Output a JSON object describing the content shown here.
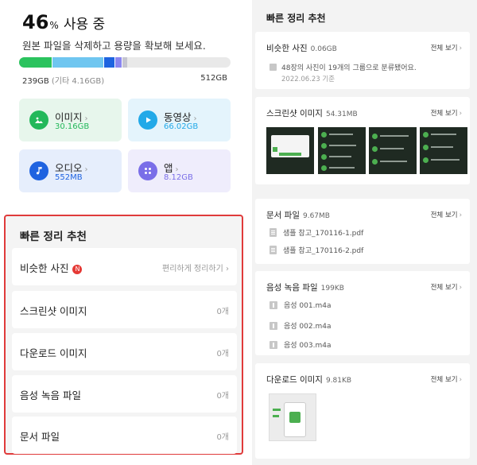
{
  "usage": {
    "percent": "46",
    "percent_unit": "%",
    "label": "사용 중",
    "subtitle": "원본 파일을 삭제하고 용량을 확보해 보세요.",
    "used": "239GB",
    "other": "(기타 4.16GB)",
    "total": "512GB",
    "bar_segments": [
      {
        "color": "#2bc35e",
        "fraction": 0.155
      },
      {
        "color": "#6fc6f0",
        "fraction": 0.245
      },
      {
        "color": "#1e64e0",
        "fraction": 0.05
      },
      {
        "color": "#8a86f0",
        "fraction": 0.035
      },
      {
        "color": "#c5c5d0",
        "fraction": 0.025
      }
    ]
  },
  "categories": [
    {
      "name": "이미지",
      "size": "30.16GB",
      "icon": "image-icon",
      "color": "#22b85a",
      "bg": "#e7f6ec",
      "size_color": "#22b85a"
    },
    {
      "name": "동영상",
      "size": "66.02GB",
      "icon": "play-icon",
      "color": "#22a9e8",
      "bg": "#e4f4fc",
      "size_color": "#22a9e8"
    },
    {
      "name": "오디오",
      "size": "552MB",
      "icon": "music-icon",
      "color": "#1f63e0",
      "bg": "#e6eefc",
      "size_color": "#1f63e0"
    },
    {
      "name": "앱",
      "size": "8.12GB",
      "icon": "apps-icon",
      "color": "#7a6ee8",
      "bg": "#efedfc",
      "size_color": "#7a6ee8"
    }
  ],
  "quick_clean": {
    "title": "빠른 정리 추천",
    "rows": [
      {
        "label": "비슷한 사진",
        "badge": "N",
        "value": "편리하게 정리하기"
      },
      {
        "label": "스크린샷 이미지",
        "value": "0개"
      },
      {
        "label": "다운로드 이미지",
        "value": "0개"
      },
      {
        "label": "음성 녹음 파일",
        "value": "0개"
      },
      {
        "label": "문서 파일",
        "value": "0개"
      }
    ]
  },
  "right": {
    "title": "빠른 정리 추천",
    "view_all": "전체 보기",
    "similar": {
      "title": "비슷한 사진",
      "size": "0.06GB",
      "desc": "48장의 사진이 19개의 그룹으로 분류됐어요.",
      "date": "2022.06.23 기준"
    },
    "screenshots": {
      "title": "스크린샷 이미지",
      "size": "54.31MB"
    },
    "docs": {
      "title": "문서 파일",
      "size": "9.67MB",
      "files": [
        "샘플 참고_170116-1.pdf",
        "샘플 참고_170116-2.pdf"
      ]
    },
    "voice": {
      "title": "음성 녹음 파일",
      "size": "199KB",
      "files": [
        "음성 001.m4a",
        "음성 002.m4a",
        "음성 003.m4a"
      ]
    },
    "download": {
      "title": "다운로드 이미지",
      "size": "9.81KB"
    }
  }
}
